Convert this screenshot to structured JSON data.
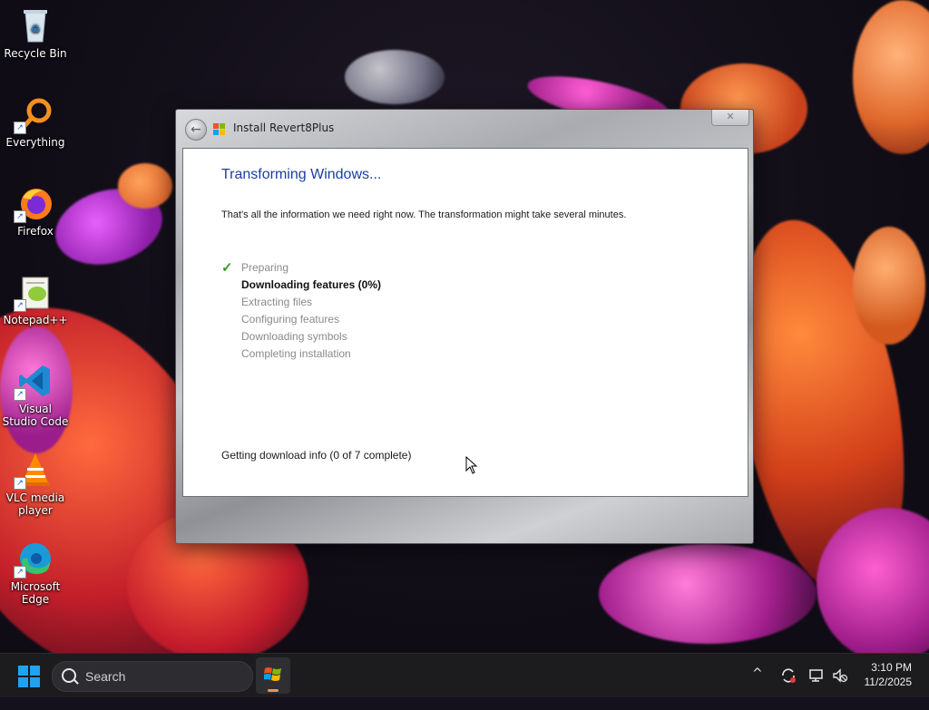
{
  "desktop": {
    "icons": [
      {
        "label": "Recycle Bin",
        "icon": "recycle-bin-icon"
      },
      {
        "label": "Everything",
        "icon": "everything-search-icon"
      },
      {
        "label": "Firefox",
        "icon": "firefox-icon"
      },
      {
        "label": "Notepad++",
        "icon": "notepad-plus-plus-icon"
      },
      {
        "label": "Visual Studio Code",
        "icon": "vscode-icon"
      },
      {
        "label": "VLC media player",
        "icon": "vlc-icon"
      },
      {
        "label": "Microsoft Edge",
        "icon": "edge-icon"
      }
    ]
  },
  "window": {
    "title": "Install Revert8Plus",
    "heading": "Transforming Windows...",
    "description": "That's all the information we need right now. The transformation might take several minutes.",
    "steps": [
      {
        "label": "Preparing",
        "state": "done"
      },
      {
        "label": "Downloading features (0%)",
        "state": "active"
      },
      {
        "label": "Extracting files",
        "state": "pending"
      },
      {
        "label": "Configuring features",
        "state": "pending"
      },
      {
        "label": "Downloading symbols",
        "state": "pending"
      },
      {
        "label": "Completing installation",
        "state": "pending"
      }
    ],
    "status": "Getting download info (0 of 7 complete)",
    "heading_color": "#1b3f9e"
  },
  "taskbar": {
    "search_placeholder": "Search",
    "clock_time": "3:10 PM",
    "clock_date": "11/2/2025",
    "accent_color": "#1fa3f0"
  }
}
